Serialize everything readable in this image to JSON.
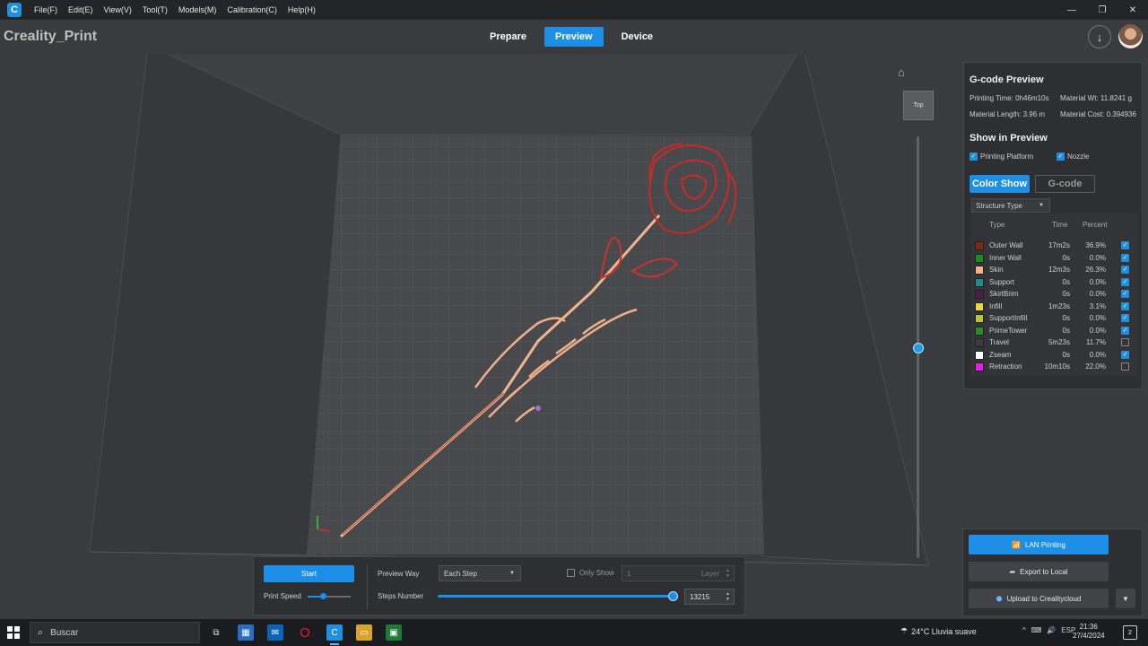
{
  "menu": {
    "items": [
      "File(F)",
      "Edit(E)",
      "View(V)",
      "Tool(T)",
      "Models(M)",
      "Calibration(C)",
      "Help(H)"
    ]
  },
  "window": {
    "minimize": "—",
    "maximize": "❐",
    "close": "✕"
  },
  "header": {
    "brand": "Creality_Print",
    "tabs": [
      {
        "label": "Prepare",
        "active": false
      },
      {
        "label": "Preview",
        "active": true
      },
      {
        "label": "Device",
        "active": false
      }
    ]
  },
  "viewport": {
    "view_cube_label": "Top",
    "layer_level": 0.5
  },
  "gcode_panel": {
    "title": "G-code Preview",
    "printing_time": "Printing Time: 0h46m10s",
    "material_weight": "Material Wt: 11.8241 g",
    "material_length": "Material Length: 3.96 m",
    "material_cost": "Material Cost: 0.394936",
    "show_title": "Show in Preview",
    "show_platform": "Printing Platform",
    "show_nozzle": "Nozzle",
    "tab_color_show": "Color Show",
    "tab_gcode": "G-code",
    "structure_select": "Structure Type",
    "headers": {
      "type": "Type",
      "time": "Time",
      "percent": "Percent"
    },
    "rows": [
      {
        "name": "Outer Wall",
        "time": "17m2s",
        "percent": "36.9%",
        "color": "#7a2a1c",
        "checked": true
      },
      {
        "name": "Inner Wall",
        "time": "0s",
        "percent": "0.0%",
        "color": "#1f8a1f",
        "checked": true
      },
      {
        "name": "Skin",
        "time": "12m3s",
        "percent": "26.3%",
        "color": "#f4b08e",
        "checked": true
      },
      {
        "name": "Support",
        "time": "0s",
        "percent": "0.0%",
        "color": "#1a8c8c",
        "checked": true
      },
      {
        "name": "SkirtBrim",
        "time": "0s",
        "percent": "0.0%",
        "color": "#4d1e4d",
        "checked": true
      },
      {
        "name": "Infill",
        "time": "1m23s",
        "percent": "3.1%",
        "color": "#e6d84a",
        "checked": true
      },
      {
        "name": "SupportInfill",
        "time": "0s",
        "percent": "0.0%",
        "color": "#b7c23d",
        "checked": true
      },
      {
        "name": "PrimeTower",
        "time": "0s",
        "percent": "0.0%",
        "color": "#2d8a2d",
        "checked": true
      },
      {
        "name": "Travel",
        "time": "5m23s",
        "percent": "11.7%",
        "color": "#3a3b3e",
        "checked": false
      },
      {
        "name": "Zseam",
        "time": "0s",
        "percent": "0.0%",
        "color": "#ffffff",
        "checked": true
      },
      {
        "name": "Retraction",
        "time": "10m10s",
        "percent": "22.0%",
        "color": "#e61ee6",
        "checked": false
      }
    ]
  },
  "export_panel": {
    "lan": "LAN Printing",
    "local": "Export to Local",
    "cloud": "Upload to Crealitycloud"
  },
  "control_bar": {
    "start": "Start",
    "print_speed": "Print Speed",
    "speed_level": 0.35,
    "preview_way_label": "Preview Way",
    "preview_way_value": "Each Step",
    "only_show": "Only Show",
    "layer_value": "1",
    "layer_unit": "Layer",
    "steps_label": "Steps Number",
    "steps_value": "13215"
  },
  "taskbar": {
    "search": "Buscar",
    "weather": "24°C  Lluvia suave",
    "lang": "ESP",
    "time": "21:36",
    "date": "27/4/2024",
    "notifications": "2"
  }
}
